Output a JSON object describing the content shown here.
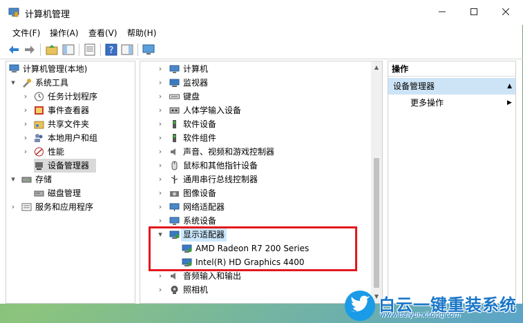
{
  "window": {
    "title": "计算机管理"
  },
  "menu": [
    "文件(F)",
    "操作(A)",
    "查看(V)",
    "帮助(H)"
  ],
  "left_tree": [
    {
      "label": "计算机管理(本地)",
      "arrow": "",
      "icon": "computer-management-icon"
    },
    {
      "label": "系统工具",
      "arrow": "▾",
      "icon": "tools-icon"
    },
    {
      "label": "任务计划程序",
      "arrow": "›",
      "icon": "clock-icon"
    },
    {
      "label": "事件查看器",
      "arrow": "›",
      "icon": "event-viewer-icon"
    },
    {
      "label": "共享文件夹",
      "arrow": "›",
      "icon": "shared-folder-icon"
    },
    {
      "label": "本地用户和组",
      "arrow": "›",
      "icon": "users-icon"
    },
    {
      "label": "性能",
      "arrow": "›",
      "icon": "performance-icon"
    },
    {
      "label": "设备管理器",
      "arrow": "",
      "icon": "device-manager-icon"
    },
    {
      "label": "存储",
      "arrow": "▾",
      "icon": "storage-icon"
    },
    {
      "label": "磁盘管理",
      "arrow": "",
      "icon": "disk-icon"
    },
    {
      "label": "服务和应用程序",
      "arrow": "›",
      "icon": "services-icon"
    }
  ],
  "device_tree": [
    {
      "label": "计算机",
      "arrow": "›",
      "icon": "computer-icon"
    },
    {
      "label": "监视器",
      "arrow": "›",
      "icon": "monitor-icon"
    },
    {
      "label": "键盘",
      "arrow": "›",
      "icon": "keyboard-icon"
    },
    {
      "label": "人体学输入设备",
      "arrow": "›",
      "icon": "hid-icon"
    },
    {
      "label": "软件设备",
      "arrow": "›",
      "icon": "software-device-icon"
    },
    {
      "label": "软件组件",
      "arrow": "›",
      "icon": "software-component-icon"
    },
    {
      "label": "声音、视频和游戏控制器",
      "arrow": "›",
      "icon": "sound-icon"
    },
    {
      "label": "鼠标和其他指针设备",
      "arrow": "›",
      "icon": "mouse-icon"
    },
    {
      "label": "通用串行总线控制器",
      "arrow": "›",
      "icon": "usb-icon"
    },
    {
      "label": "图像设备",
      "arrow": "›",
      "icon": "camera-device-icon"
    },
    {
      "label": "网络适配器",
      "arrow": "›",
      "icon": "network-icon"
    },
    {
      "label": "系统设备",
      "arrow": "›",
      "icon": "system-device-icon"
    },
    {
      "label": "显示适配器",
      "arrow": "▾",
      "icon": "display-adapter-icon"
    },
    {
      "label": "AMD Radeon R7 200 Series",
      "arrow": "",
      "icon": "gpu-icon"
    },
    {
      "label": "Intel(R) HD Graphics 4400",
      "arrow": "",
      "icon": "gpu-icon"
    },
    {
      "label": "音频输入和输出",
      "arrow": "›",
      "icon": "audio-icon"
    },
    {
      "label": "照相机",
      "arrow": "›",
      "icon": "webcam-icon"
    }
  ],
  "actions": {
    "header": "操作",
    "section": "设备管理器",
    "item": "更多操作"
  },
  "watermark": {
    "name": "白云一键重装系统",
    "url": "www.baiyunxitong.com"
  },
  "colors": {
    "highlight_box": "#e3171d",
    "selection": "#cce8ff",
    "accent": "#1a76c8"
  }
}
